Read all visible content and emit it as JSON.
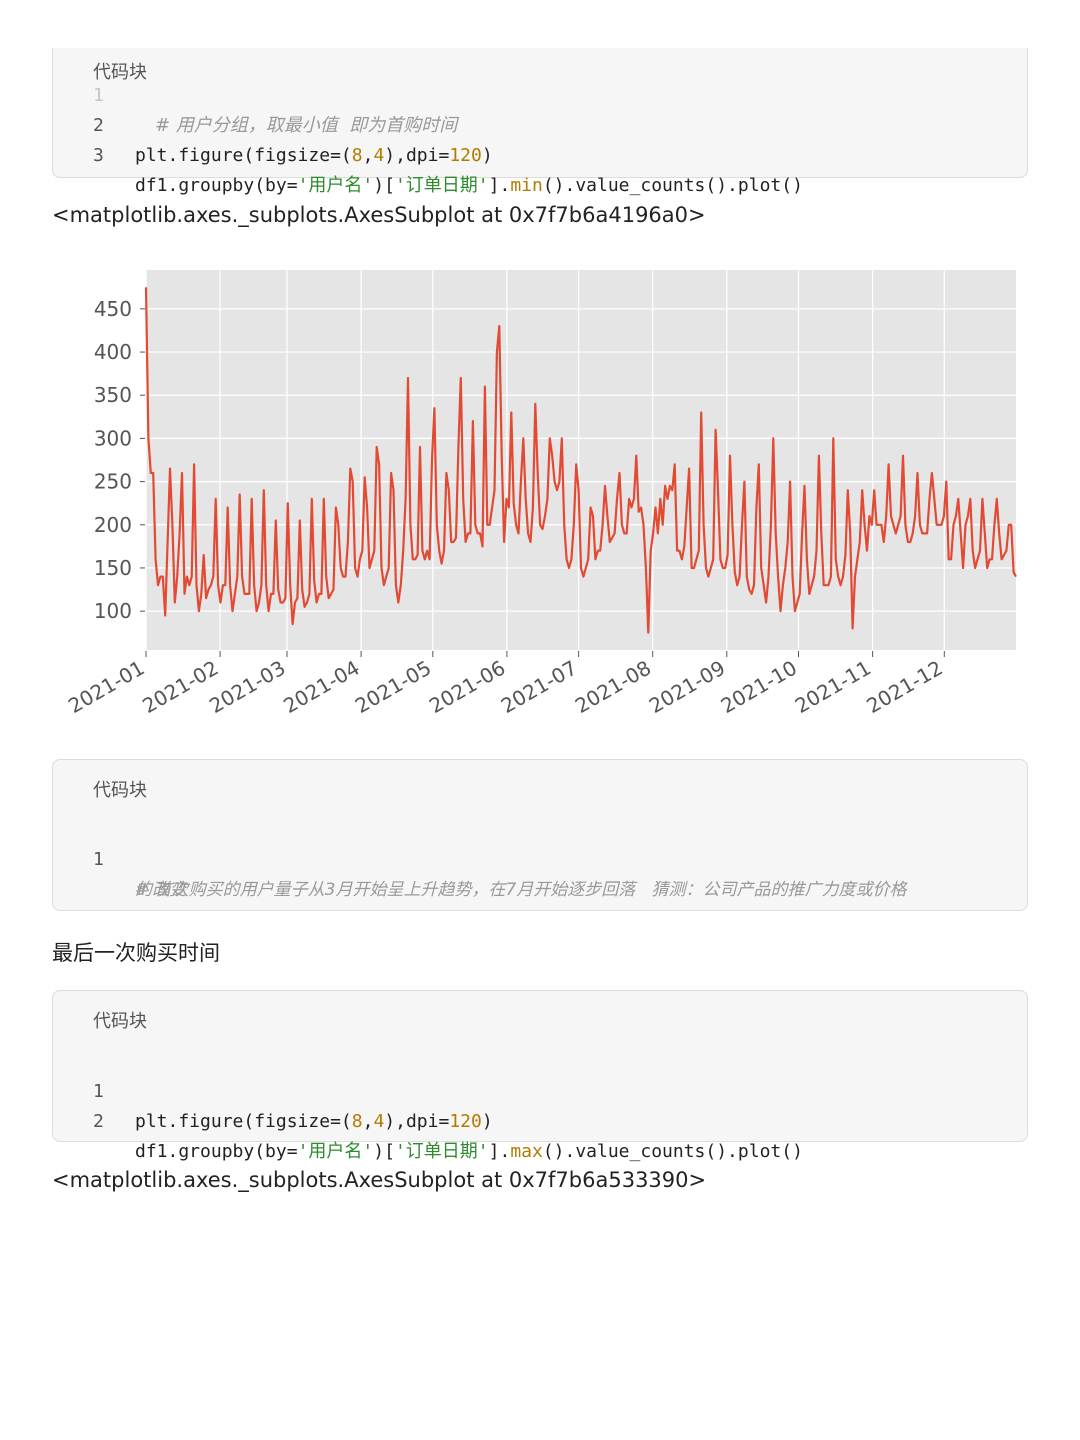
{
  "block1": {
    "header": "代码块",
    "lines": [
      {
        "num": "1",
        "comment": "# 用户分组，取最小值  即为首购时间"
      },
      {
        "num": "2",
        "pre": "plt.figure(figsize=(",
        "n1": "8",
        "mid": ",",
        "n2": "4",
        "post": "),dpi=",
        "n3": "120",
        "end": ")"
      },
      {
        "num": "3",
        "pre": "df1.groupby(by=",
        "s1": "'用户名'",
        "mid": ")[",
        "s2": "'订单日期'",
        "post": "].",
        "fn": "min",
        "end": "().value_counts().plot()"
      }
    ]
  },
  "output1": "<matplotlib.axes._subplots.AxesSubplot at 0x7f7b6a4196a0>",
  "block2": {
    "header": "代码块",
    "line_num": "1",
    "comment_a": "# 首次购买的用户量子从3月开始呈上升趋势，在7月开始逐步回落   猜测：公司产品的推广力度或价格",
    "comment_b": "的改变"
  },
  "heading": "最后一次购买时间",
  "block3": {
    "header": "代码块",
    "lines": [
      {
        "num": "1",
        "pre": "plt.figure(figsize=(",
        "n1": "8",
        "mid": ",",
        "n2": "4",
        "post": "),dpi=",
        "n3": "120",
        "end": ")"
      },
      {
        "num": "2",
        "pre": "df1.groupby(by=",
        "s1": "'用户名'",
        "mid": ")[",
        "s2": "'订单日期'",
        "post": "].",
        "fn": "max",
        "end": "().value_counts().plot()"
      }
    ]
  },
  "output2": "<matplotlib.axes._subplots.AxesSubplot at 0x7f7b6a533390>",
  "colors": {
    "line": "#e24a33",
    "plot_bg": "#e5e5e5",
    "grid": "#ffffff"
  },
  "chart_data": {
    "type": "line",
    "title": "",
    "xlabel": "",
    "ylabel": "",
    "grid": true,
    "ylim": [
      55,
      495
    ],
    "yticks": [
      100,
      150,
      200,
      250,
      300,
      350,
      400,
      450
    ],
    "xtick_labels": [
      "2021-01",
      "2021-02",
      "2021-03",
      "2021-04",
      "2021-05",
      "2021-06",
      "2021-07",
      "2021-08",
      "2021-09",
      "2021-10",
      "2021-11",
      "2021-12"
    ],
    "x_start": "2021-01-01",
    "x_end": "2021-12-31",
    "series": [
      {
        "values": [
          475,
          300,
          260,
          260,
          160,
          130,
          140,
          140,
          95,
          180,
          265,
          200,
          110,
          140,
          190,
          260,
          120,
          140,
          130,
          140,
          270,
          130,
          100,
          120,
          165,
          115,
          125,
          130,
          140,
          230,
          130,
          110,
          130,
          130,
          220,
          130,
          100,
          120,
          140,
          235,
          140,
          120,
          120,
          120,
          230,
          130,
          100,
          110,
          130,
          240,
          130,
          100,
          120,
          120,
          205,
          125,
          110,
          110,
          115,
          225,
          130,
          85,
          110,
          115,
          205,
          125,
          105,
          110,
          120,
          230,
          135,
          110,
          120,
          120,
          230,
          140,
          115,
          120,
          125,
          220,
          200,
          150,
          140,
          140,
          180,
          265,
          250,
          150,
          140,
          160,
          170,
          255,
          220,
          150,
          160,
          170,
          290,
          270,
          150,
          130,
          140,
          150,
          260,
          240,
          130,
          110,
          130,
          170,
          230,
          370,
          200,
          160,
          160,
          165,
          290,
          170,
          160,
          170,
          160,
          275,
          335,
          200,
          170,
          155,
          170,
          260,
          240,
          180,
          180,
          185,
          290,
          370,
          230,
          180,
          190,
          190,
          320,
          200,
          190,
          190,
          175,
          360,
          200,
          200,
          220,
          240,
          400,
          430,
          280,
          180,
          230,
          220,
          330,
          225,
          200,
          190,
          250,
          300,
          230,
          190,
          180,
          220,
          340,
          260,
          200,
          195,
          210,
          230,
          300,
          280,
          250,
          240,
          250,
          300,
          200,
          160,
          150,
          160,
          200,
          270,
          240,
          150,
          140,
          150,
          160,
          220,
          210,
          160,
          170,
          170,
          200,
          245,
          210,
          180,
          185,
          190,
          230,
          260,
          200,
          190,
          190,
          230,
          220,
          230,
          280,
          215,
          220,
          200,
          150,
          75,
          170,
          190,
          220,
          190,
          230,
          200,
          245,
          230,
          245,
          240,
          270,
          170,
          170,
          160,
          175,
          220,
          265,
          150,
          150,
          160,
          170,
          330,
          200,
          150,
          140,
          150,
          160,
          310,
          240,
          160,
          150,
          150,
          165,
          280,
          200,
          145,
          130,
          140,
          200,
          250,
          140,
          125,
          120,
          130,
          220,
          270,
          150,
          130,
          110,
          140,
          200,
          300,
          190,
          140,
          100,
          130,
          150,
          180,
          250,
          140,
          100,
          110,
          120,
          190,
          245,
          160,
          120,
          130,
          140,
          170,
          280,
          190,
          130,
          130,
          130,
          140,
          300,
          160,
          140,
          130,
          140,
          165,
          240,
          190,
          80,
          140,
          160,
          180,
          240,
          200,
          170,
          210,
          200,
          240,
          200,
          200,
          200,
          180,
          210,
          270,
          210,
          200,
          190,
          200,
          210,
          280,
          200,
          180,
          180,
          190,
          210,
          260,
          200,
          190,
          190,
          190,
          230,
          260,
          230,
          200,
          200,
          200,
          210,
          250,
          160,
          160,
          200,
          210,
          230,
          190,
          150,
          200,
          210,
          230,
          170,
          150,
          160,
          170,
          230,
          190,
          150,
          160,
          160,
          200,
          230,
          190,
          160,
          165,
          170,
          200,
          200,
          145,
          140
        ]
      }
    ]
  }
}
